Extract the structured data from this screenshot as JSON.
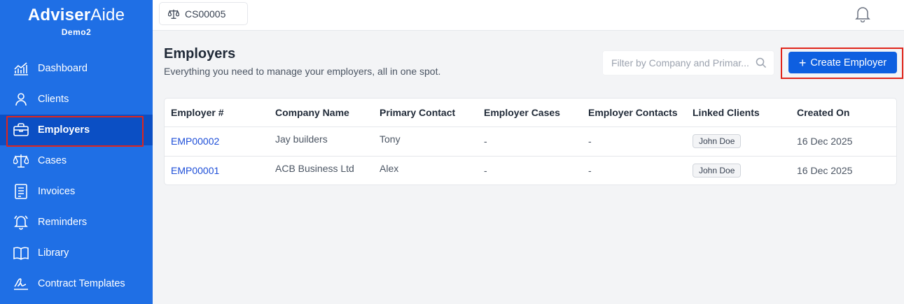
{
  "brand": {
    "name_bold": "Adviser",
    "name_light": "Aide",
    "sub": "Demo2"
  },
  "sidebar": {
    "items": [
      {
        "label": "Dashboard",
        "icon": "chart-icon"
      },
      {
        "label": "Clients",
        "icon": "user-icon"
      },
      {
        "label": "Employers",
        "icon": "briefcase-icon",
        "active": true
      },
      {
        "label": "Cases",
        "icon": "scales-icon"
      },
      {
        "label": "Invoices",
        "icon": "invoice-icon"
      },
      {
        "label": "Reminders",
        "icon": "bell-icon"
      },
      {
        "label": "Library",
        "icon": "book-icon"
      },
      {
        "label": "Contract Templates",
        "icon": "signature-icon"
      }
    ]
  },
  "topbar": {
    "case_label": "CS00005"
  },
  "page": {
    "title": "Employers",
    "subtitle": "Everything you need to manage your employers, all in one spot.",
    "filter_placeholder": "Filter by Company and Primar...",
    "create_label": "Create Employer"
  },
  "table": {
    "headers": [
      "Employer #",
      "Company Name",
      "Primary Contact",
      "Employer Cases",
      "Employer Contacts",
      "Linked Clients",
      "Created On"
    ],
    "rows": [
      {
        "id": "EMP00002",
        "company": "Jay builders",
        "contact": "Tony",
        "cases": "-",
        "contacts": "-",
        "linked": "John Doe",
        "created": "16 Dec 2025"
      },
      {
        "id": "EMP00001",
        "company": "ACB Business Ltd",
        "contact": "Alex",
        "cases": "-",
        "contacts": "-",
        "linked": "John Doe",
        "created": "16 Dec 2025"
      }
    ]
  },
  "colors": {
    "sidebar": "#1f6fe5",
    "active": "#0b4fc4",
    "accent": "#0e5fe0",
    "highlight": "#e0251b"
  }
}
